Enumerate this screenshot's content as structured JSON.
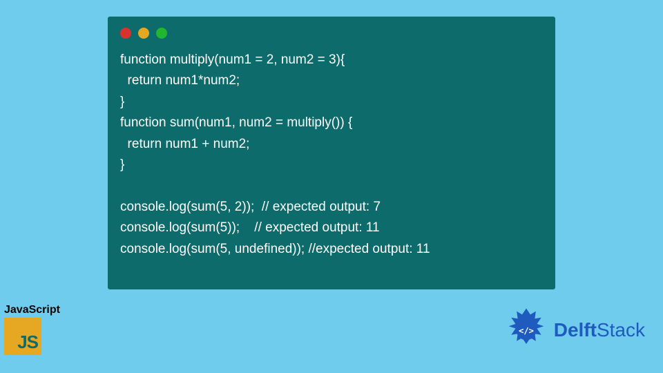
{
  "code": {
    "lines": [
      "function multiply(num1 = 2, num2 = 3){",
      "  return num1*num2;",
      "}",
      "function sum(num1, num2 = multiply()) {",
      "  return num1 + num2;",
      "}",
      "",
      "console.log(sum(5, 2));  // expected output: 7",
      "console.log(sum(5));    // expected output: 11",
      "console.log(sum(5, undefined)); //expected output: 11"
    ]
  },
  "js_badge": {
    "label": "JavaScript",
    "logo_text": "JS"
  },
  "delft_badge": {
    "text_bold": "Delft",
    "text_light": "Stack"
  },
  "colors": {
    "background": "#6fcced",
    "window": "#0d6c6b",
    "js_logo": "#e6a822",
    "delft_blue": "#1f5abf"
  }
}
